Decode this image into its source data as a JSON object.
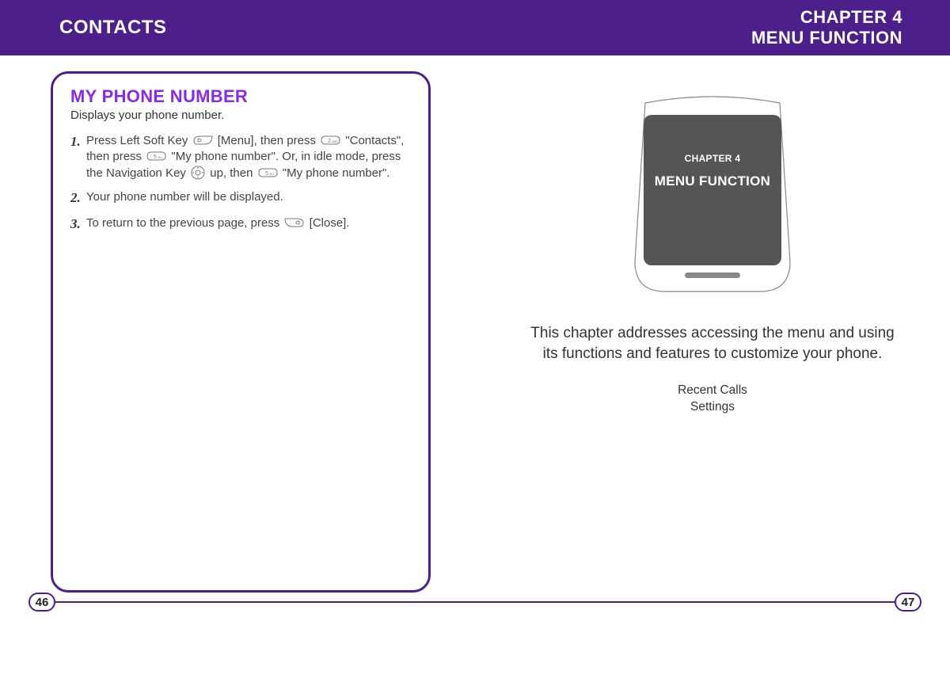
{
  "header": {
    "left": "CONTACTS",
    "right_line1": "CHAPTER 4",
    "right_line2": "MENU FUNCTION"
  },
  "left_page": {
    "callout_title": "MY PHONE NUMBER",
    "callout_sub": "Displays your phone number.",
    "steps": [
      {
        "num": "1.",
        "parts": [
          {
            "t": "text",
            "v": "Press Left Soft Key "
          },
          {
            "t": "icon",
            "v": "left-soft-key"
          },
          {
            "t": "text",
            "v": " [Menu], then press "
          },
          {
            "t": "icon",
            "v": "key-2"
          },
          {
            "t": "text",
            "v": " \"Contacts\", then press "
          },
          {
            "t": "icon",
            "v": "key-5"
          },
          {
            "t": "text",
            "v": " \"My phone number\". Or, in idle mode, press the Navigation Key "
          },
          {
            "t": "icon",
            "v": "nav-key"
          },
          {
            "t": "text",
            "v": "  up, then "
          },
          {
            "t": "icon",
            "v": "key-5"
          },
          {
            "t": "text",
            "v": " \"My phone number\"."
          }
        ]
      },
      {
        "num": "2.",
        "parts": [
          {
            "t": "text",
            "v": "Your phone number will be displayed."
          }
        ]
      },
      {
        "num": "3.",
        "parts": [
          {
            "t": "text",
            "v": "To return to the previous page, press "
          },
          {
            "t": "icon",
            "v": "right-soft-key"
          },
          {
            "t": "text",
            "v": " [Close]."
          }
        ]
      }
    ],
    "page_number": "46"
  },
  "right_page": {
    "phone": {
      "chapter_label": "CHAPTER 4",
      "title": "MENU FUNCTION"
    },
    "description": "This chapter addresses accessing the menu and using its functions and features to customize your phone.",
    "topics": [
      "Recent Calls",
      "Settings"
    ],
    "page_number": "47"
  },
  "icons": {
    "left-soft-key": "left-soft-key-icon",
    "right-soft-key": "right-soft-key-icon",
    "key-2": "key-2-icon",
    "key-5": "key-5-icon",
    "nav-key": "nav-key-icon"
  }
}
